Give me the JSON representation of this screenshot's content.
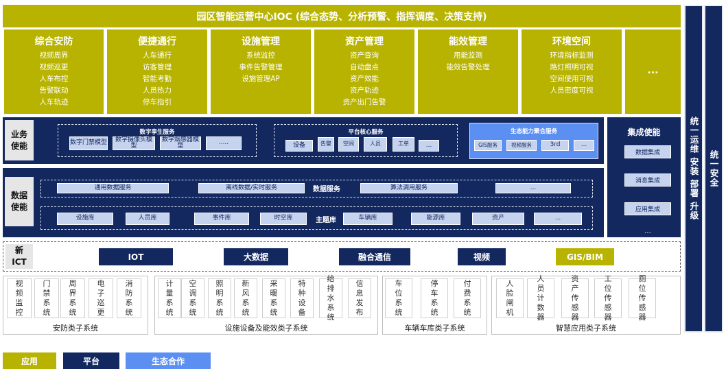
{
  "banner": "园区智能运营中心IOC (综合态势、分析预警、指挥调度、决策支持)",
  "apps": [
    {
      "title": "综合安防",
      "items": [
        "视频周界",
        "视频巡更",
        "人车布控",
        "告警联动",
        "人车轨迹"
      ]
    },
    {
      "title": "便捷通行",
      "items": [
        "人车通行",
        "访客管理",
        "智能考勤",
        "人员热力",
        "停车指引"
      ]
    },
    {
      "title": "设施管理",
      "items": [
        "系统监控",
        "事件告警管理",
        "设施管理AP"
      ]
    },
    {
      "title": "资产管理",
      "items": [
        "资产查询",
        "自动盘点",
        "资产效能",
        "资产轨迹",
        "资产出门告警"
      ]
    },
    {
      "title": "能效管理",
      "items": [
        "用能监测",
        "能效告警处理"
      ]
    },
    {
      "title": "环境空间",
      "items": [
        "环境指标监测",
        "路灯照明可视",
        "空间使用可视",
        "人员密度可视"
      ]
    },
    {
      "title": "...",
      "items": []
    }
  ],
  "business": {
    "label": "业务\n使能",
    "twin": {
      "title": "数字孪生服务",
      "chips": [
        "数字门禁模型",
        "数字摄像头模型",
        "数字烟感器模型",
        "....."
      ]
    },
    "core": {
      "title": "平台核心服务",
      "chips": [
        "设备",
        "告警",
        "空间",
        "人员",
        "工单",
        "..."
      ]
    },
    "eco": {
      "title": "生态能力聚合服务",
      "chips": [
        "GIS服务",
        "视频服务",
        "3rd",
        "..."
      ]
    }
  },
  "data_enable": {
    "label": "数据\n使能",
    "services_label": "数据服务",
    "services": [
      "通用数据服务",
      "离线数据/实时服务",
      "算法调用服务",
      "..."
    ],
    "topic_label": "主题库",
    "topics": [
      "设施库",
      "人员库",
      "事件库",
      "时空库",
      "车辆库",
      "能源库",
      "资产",
      "..."
    ]
  },
  "integration": {
    "title": "集成使能",
    "items": [
      "数据集成",
      "消息集成",
      "应用集成",
      "..."
    ]
  },
  "ict": {
    "label": "新\nICT",
    "items": [
      "IOT",
      "大数据",
      "融合通信",
      "视频",
      "GIS/BIM"
    ]
  },
  "subsystems": [
    {
      "title": "安防类子系统",
      "items": [
        "视频监控",
        "门禁系统",
        "周界系统",
        "电子巡更",
        "消防系统"
      ]
    },
    {
      "title": "设施设备及能效类子系统",
      "items": [
        "计量系统",
        "空调系统",
        "照明系统",
        "新风系统",
        "采暖系统",
        "特种设备",
        "给排水系统",
        "信息发布"
      ]
    },
    {
      "title": "车辆车库类子系统",
      "items": [
        "车位系统",
        "停车系统",
        "付费系统"
      ]
    },
    {
      "title": "智慧应用类子系统",
      "items": [
        "人脸闸机",
        "人员计数器",
        "资产传感器",
        "工位传感器",
        "厕位传感器"
      ]
    }
  ],
  "right_bars": [
    "统一运维 安装 部署 升级",
    "统一安全"
  ],
  "legend": [
    "应用",
    "平台",
    "生态合作"
  ],
  "colors": {
    "application": "#b7b300",
    "platform": "#13285f",
    "ecosystem": "#5b8ff2"
  }
}
